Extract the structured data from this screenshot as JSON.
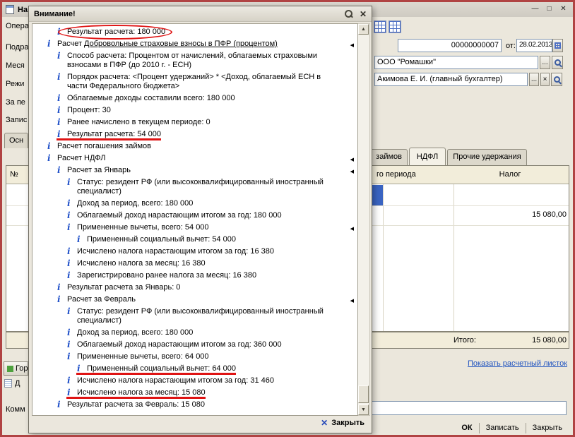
{
  "annotation_color": "#df1414",
  "icons": {
    "scroll_up": "▲",
    "scroll_down": "▼",
    "collapse_arrow": "◀",
    "dialog_close": "✕",
    "footer_close_x": "✕"
  },
  "main_window": {
    "title": "На",
    "window_controls": {
      "minimize": "—",
      "maximize": "□",
      "close": "✕"
    },
    "menu_fragment": "Опера",
    "left_labels": {
      "l1": "Подраз",
      "l2": "Меся",
      "l3": "Режи",
      "l4": "За пе",
      "l5": "Запис",
      "tab_fragment": "Осн",
      "green_button": "Гори",
      "d_fragment": "Д",
      "comment": "Комм"
    },
    "fields": {
      "doc_number": "00000000007",
      "date_label": "от:",
      "date_value": "28.02.2013",
      "organization": "ООО \"Ромашки\"",
      "responsible": "Акимова Е. И. (главный бухгалтер)",
      "ellipsis_button": "...",
      "clear_button": "×"
    },
    "tabs": [
      {
        "label": "займов"
      },
      {
        "label": "НДФЛ"
      },
      {
        "label": "Прочие удержания"
      }
    ],
    "table": {
      "header_num": "№",
      "header_col1": "го периода",
      "header_col2": "Налог",
      "row_value": "15 080,00",
      "total_label": "Итого:",
      "total_value": "15 080,00"
    },
    "payslip_link": "Показать расчетный листок",
    "buttons": {
      "ok": "ОК",
      "save": "Записать",
      "close": "Закрыть"
    }
  },
  "dialog": {
    "title": "Внимание!",
    "footer_close_label": "Закрыть",
    "items": [
      {
        "text": "Результат расчета: 180 000",
        "level": 2,
        "mark": "ellipse"
      },
      {
        "prefix": "Расчет ",
        "text": "Добровольные страховые взносы в ПФР (процентом)",
        "level": 1,
        "link": true,
        "arrow": true
      },
      {
        "text": "Способ расчета: Процентом от начислений, облагаемых страховыми взносами в ПФР (до 2010 г. - ЕСН)",
        "level": 2
      },
      {
        "text": "Порядок расчета: <Процент удержаний> * <Доход, облагаемый ЕСН в части Федерального бюджета>",
        "level": 2
      },
      {
        "text": "Облагаемые доходы составили всего: 180 000",
        "level": 2
      },
      {
        "text": "Процент: 30",
        "level": 2
      },
      {
        "text": "Ранее начислено в текущем периоде: 0",
        "level": 2
      },
      {
        "text": "Результат расчета: 54 000",
        "level": 2,
        "mark": "underline"
      },
      {
        "text": "Расчет погашения займов",
        "level": 1
      },
      {
        "text": "Расчет НДФЛ",
        "level": 1,
        "arrow": true
      },
      {
        "text": "Расчет за Январь",
        "level": 2,
        "arrow": true
      },
      {
        "text": "Статус: резидент РФ (или высококвалифицированный иностранный специалист)",
        "level": 3
      },
      {
        "text": "Доход за период, всего: 180 000",
        "level": 3
      },
      {
        "text": "Облагаемый доход нарастающим итогом за год: 180 000",
        "level": 3
      },
      {
        "text": "Примененные вычеты, всего: 54 000",
        "level": 3,
        "arrow": true
      },
      {
        "text": "Примененный социальный вычет: 54 000",
        "level": 4
      },
      {
        "text": "Исчислено налога нарастающим итогом за год: 16 380",
        "level": 3
      },
      {
        "text": "Исчислено налога за месяц: 16 380",
        "level": 3
      },
      {
        "text": "Зарегистрировано ранее налога за месяц: 16 380",
        "level": 3
      },
      {
        "text": "Результат расчета за Январь: 0",
        "level": 2
      },
      {
        "text": "Расчет за Февраль",
        "level": 2,
        "arrow": true
      },
      {
        "text": "Статус: резидент РФ (или высококвалифицированный иностранный специалист)",
        "level": 3
      },
      {
        "text": "Доход за период, всего: 180 000",
        "level": 3
      },
      {
        "text": "Облагаемый доход нарастающим итогом за год: 360 000",
        "level": 3
      },
      {
        "text": "Примененные вычеты, всего: 64 000",
        "level": 3
      },
      {
        "text": "Примененный социальный вычет: 64 000",
        "level": 4,
        "mark": "underline"
      },
      {
        "text": "Исчислено налога нарастающим итогом за год: 31 460",
        "level": 3
      },
      {
        "text": "Исчислено налога за месяц: 15 080",
        "level": 3,
        "mark": "underline"
      },
      {
        "text": "Результат расчета за Февраль: 15 080",
        "level": 2
      }
    ]
  }
}
